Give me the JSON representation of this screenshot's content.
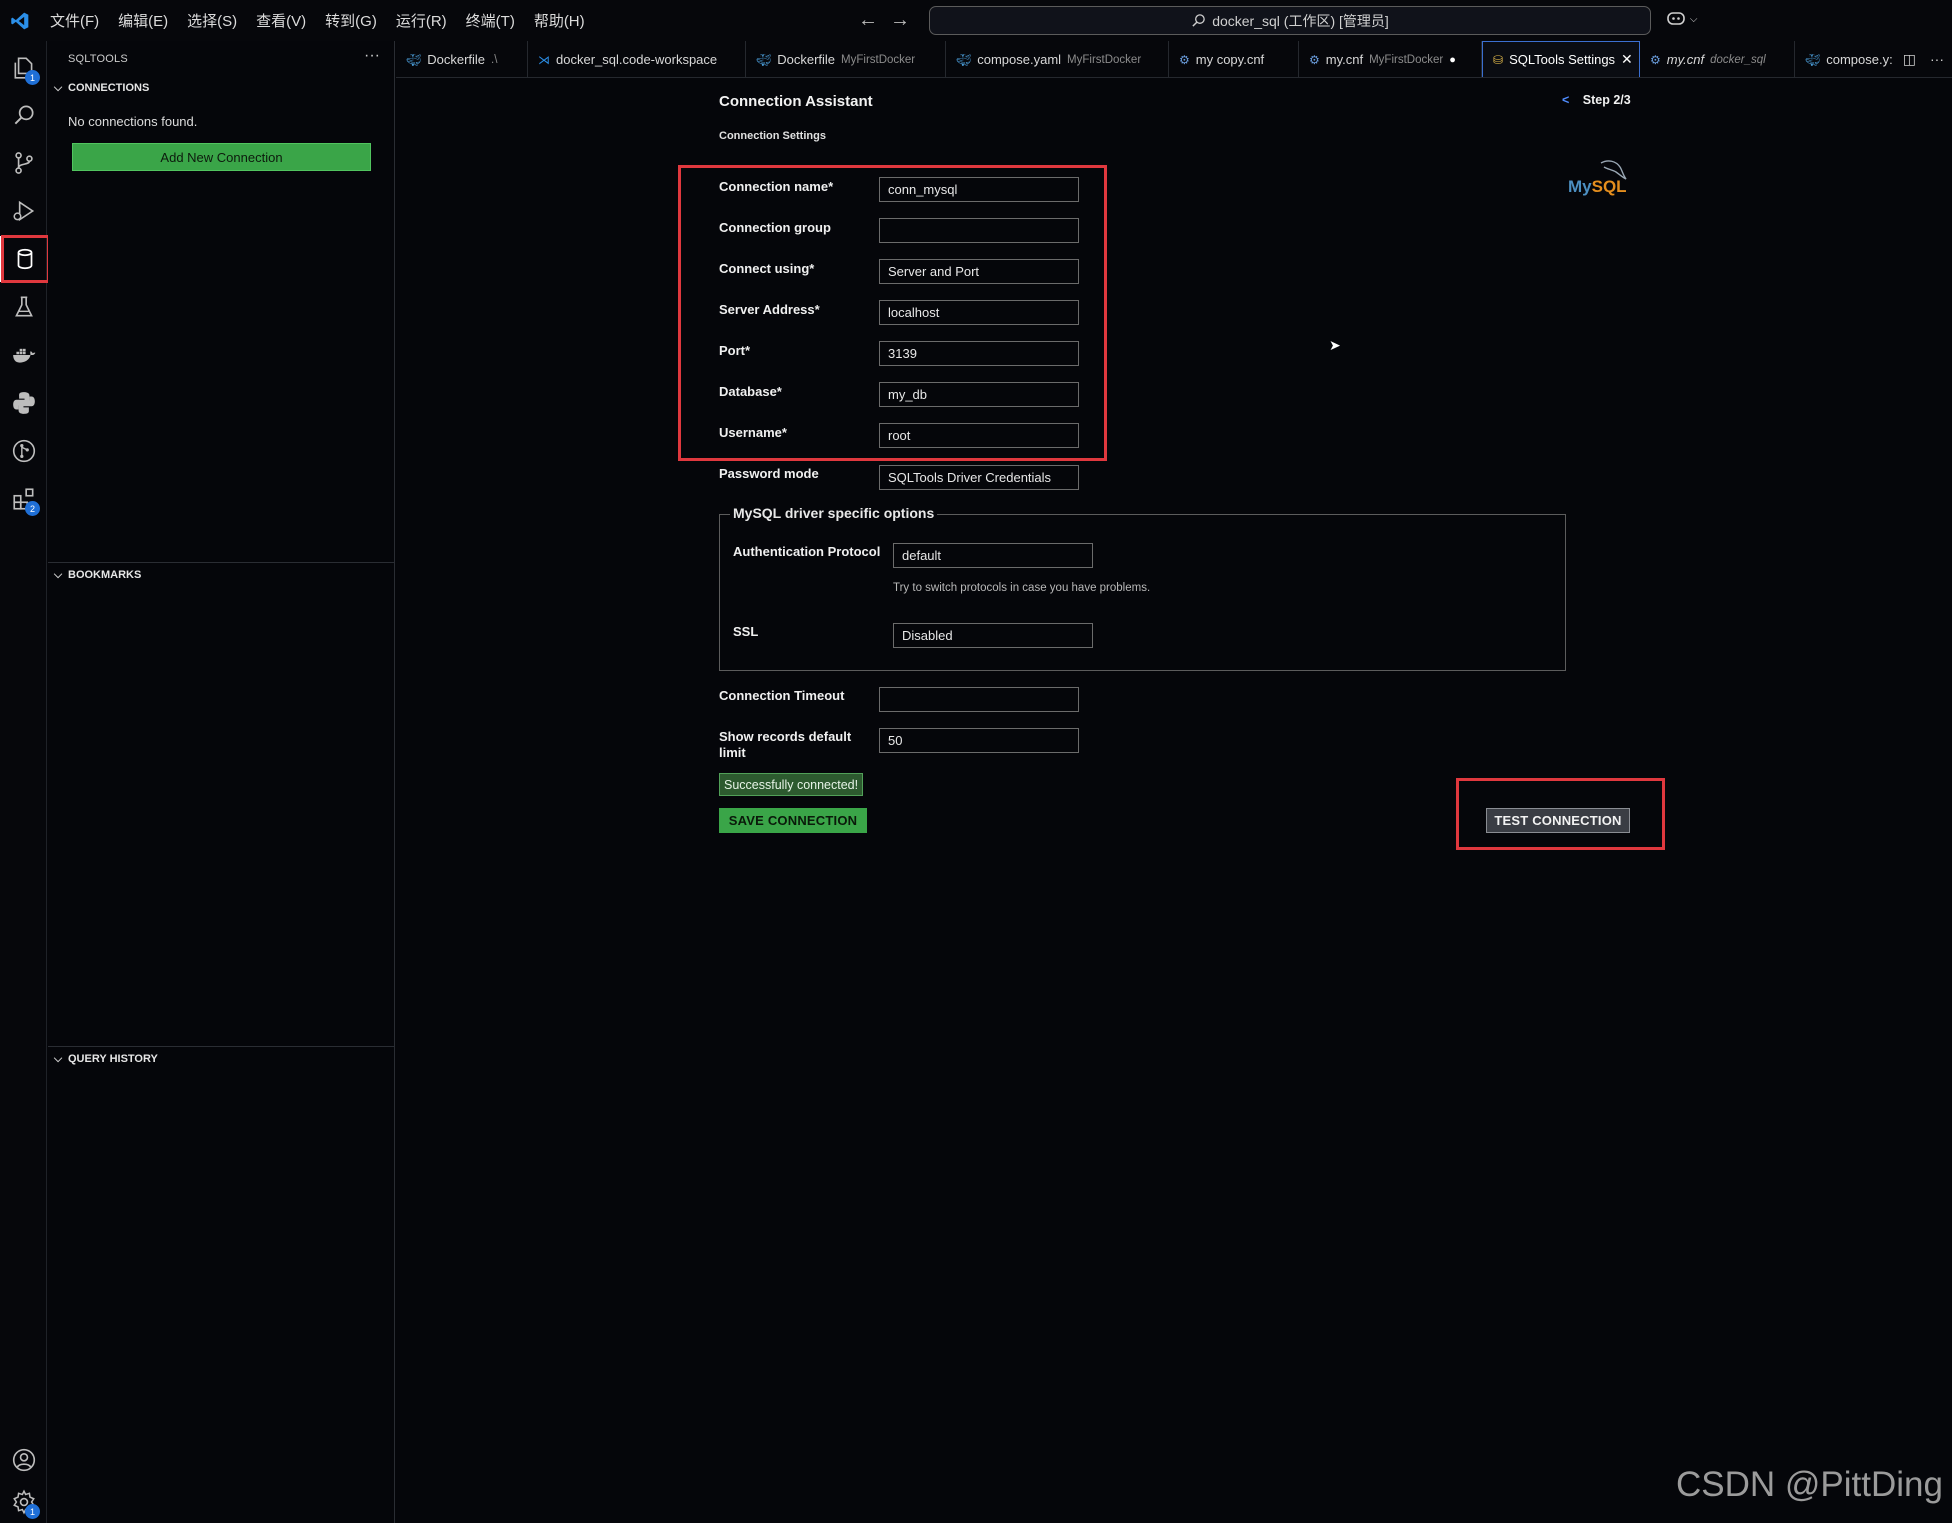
{
  "titlebar": {
    "menu": [
      "文件(F)",
      "编辑(E)",
      "选择(S)",
      "查看(V)",
      "转到(G)",
      "运行(R)",
      "终端(T)",
      "帮助(H)"
    ],
    "search_text": "docker_sql (工作区) [管理员]"
  },
  "activitybar": {
    "explorer_badge": "1",
    "extensions_badge": "2",
    "settings_badge": "1"
  },
  "sidebar": {
    "title": "SQLTOOLS",
    "connections_header": "CONNECTIONS",
    "no_connections": "No connections found.",
    "add_button": "Add New Connection",
    "bookmarks_header": "BOOKMARKS",
    "history_header": "QUERY HISTORY"
  },
  "tabs": [
    {
      "label": "Dockerfile",
      "desc": ".\\",
      "icon": "docker-icon"
    },
    {
      "label": "docker_sql.code-workspace",
      "desc": "",
      "icon": "vscode-icon"
    },
    {
      "label": "Dockerfile",
      "desc": "MyFirstDocker",
      "icon": "docker-icon"
    },
    {
      "label": "compose.yaml",
      "desc": "MyFirstDocker",
      "icon": "docker-icon"
    },
    {
      "label": "my copy.cnf",
      "desc": "",
      "icon": "gear-icon"
    },
    {
      "label": "my.cnf",
      "desc": "MyFirstDocker",
      "icon": "gear-icon"
    },
    {
      "label": "SQLTools Settings",
      "desc": "",
      "icon": "database-icon"
    },
    {
      "label": "my.cnf",
      "desc": "docker_sql",
      "icon": "gear-icon"
    },
    {
      "label": "compose.y:",
      "desc": "",
      "icon": "docker-icon"
    }
  ],
  "form": {
    "title": "Connection Assistant",
    "subtitle": "Connection Settings",
    "step_back": "<",
    "step": "Step 2/3",
    "logo_my": "My",
    "logo_sql": "SQL",
    "fields": {
      "connection_name": {
        "label": "Connection name*",
        "value": "conn_mysql"
      },
      "connection_group": {
        "label": "Connection group",
        "value": ""
      },
      "connect_using": {
        "label": "Connect using*",
        "value": "Server and Port"
      },
      "server_address": {
        "label": "Server Address*",
        "value": "localhost"
      },
      "port": {
        "label": "Port*",
        "value": "3139"
      },
      "database": {
        "label": "Database*",
        "value": "my_db"
      },
      "username": {
        "label": "Username*",
        "value": "root"
      },
      "password_mode": {
        "label": "Password mode",
        "value": "SQLTools Driver Credentials"
      }
    },
    "driver": {
      "legend": "MySQL driver specific options",
      "auth_label": "Authentication Protocol",
      "auth_value": "default",
      "auth_hint": "Try to switch protocols in case you have problems.",
      "ssl_label": "SSL",
      "ssl_value": "Disabled"
    },
    "timeout": {
      "label": "Connection Timeout",
      "value": ""
    },
    "limit": {
      "label": "Show records default limit",
      "value": "50"
    },
    "success": "Successfully connected!",
    "save_button": "SAVE CONNECTION",
    "test_button": "TEST CONNECTION"
  },
  "watermark": "CSDN @PittDing",
  "colors": {
    "accent_green": "#3aa548",
    "highlight_red": "#e0383e",
    "active_tab_border": "#3b6fd0",
    "background": "#05060a"
  }
}
